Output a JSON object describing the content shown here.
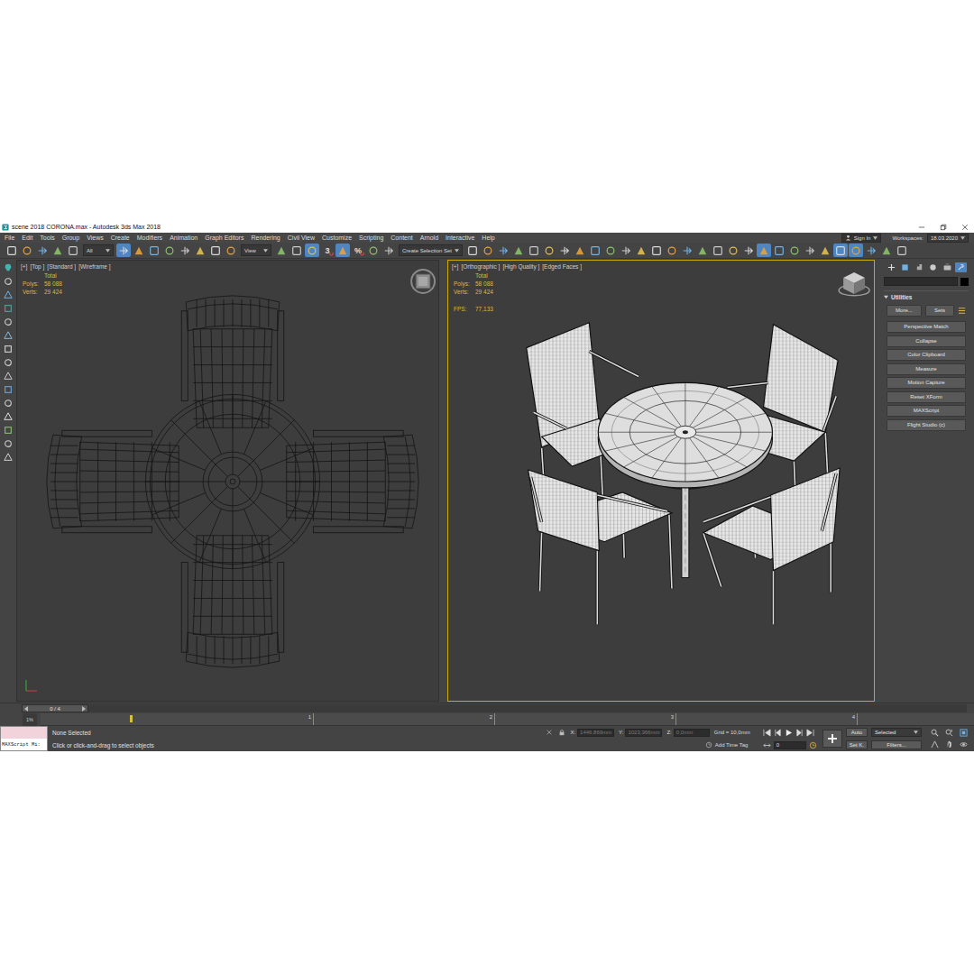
{
  "window": {
    "title": "scene 2018 CORONA.max - Autodesk 3ds Max 2018"
  },
  "menu": [
    "File",
    "Edit",
    "Tools",
    "Group",
    "Views",
    "Create",
    "Modifiers",
    "Animation",
    "Graph Editors",
    "Rendering",
    "Civil View",
    "Customize",
    "Scripting",
    "Content",
    "Arnold",
    "Interactive",
    "Help"
  ],
  "account": {
    "label": "Sign In"
  },
  "workspaces": {
    "label": "Workspaces:",
    "value": "18.03.2020"
  },
  "toolbar": [
    {
      "kind": "icon",
      "active": false
    },
    {
      "kind": "icon",
      "active": false
    },
    {
      "kind": "icon",
      "active": false
    },
    {
      "kind": "icon",
      "active": false
    },
    {
      "kind": "icon",
      "active": false
    },
    {
      "kind": "dropdown",
      "label": "All"
    },
    {
      "kind": "icon",
      "active": true
    },
    {
      "kind": "icon",
      "active": false
    },
    {
      "kind": "icon",
      "active": false
    },
    {
      "kind": "icon",
      "active": false
    },
    {
      "kind": "icon",
      "active": false
    },
    {
      "kind": "icon",
      "active": false
    },
    {
      "kind": "icon",
      "active": false
    },
    {
      "kind": "icon",
      "active": false
    },
    {
      "kind": "dropdown",
      "label": "View"
    },
    {
      "kind": "icon",
      "active": false
    },
    {
      "kind": "icon",
      "active": false
    },
    {
      "kind": "icon",
      "active": true
    },
    {
      "kind": "glyph",
      "label": "3",
      "active": false
    },
    {
      "kind": "icon",
      "active": true
    },
    {
      "kind": "glyph",
      "label": "%",
      "active": false
    },
    {
      "kind": "icon",
      "active": false
    },
    {
      "kind": "icon",
      "active": false
    },
    {
      "kind": "dropdown",
      "label": "Create Selection Set"
    },
    {
      "kind": "icon",
      "active": false
    },
    {
      "kind": "icon",
      "active": false
    },
    {
      "kind": "icon",
      "active": false
    },
    {
      "kind": "icon",
      "active": false
    },
    {
      "kind": "icon",
      "active": false
    },
    {
      "kind": "icon",
      "active": false
    },
    {
      "kind": "icon",
      "active": false
    },
    {
      "kind": "icon",
      "active": false
    },
    {
      "kind": "icon",
      "active": false
    },
    {
      "kind": "icon",
      "active": false
    },
    {
      "kind": "icon",
      "active": false
    },
    {
      "kind": "icon",
      "active": false
    },
    {
      "kind": "icon",
      "active": false
    },
    {
      "kind": "icon",
      "active": false
    },
    {
      "kind": "icon",
      "active": false
    },
    {
      "kind": "icon",
      "active": false
    },
    {
      "kind": "icon",
      "active": false
    },
    {
      "kind": "icon",
      "active": false
    },
    {
      "kind": "icon",
      "active": false
    },
    {
      "kind": "icon",
      "active": true
    },
    {
      "kind": "icon",
      "active": false
    },
    {
      "kind": "icon",
      "active": false
    },
    {
      "kind": "icon",
      "active": false
    },
    {
      "kind": "icon",
      "active": false
    },
    {
      "kind": "icon",
      "active": true
    },
    {
      "kind": "icon",
      "active": true
    },
    {
      "kind": "icon",
      "active": false
    },
    {
      "kind": "icon",
      "active": false
    },
    {
      "kind": "icon",
      "active": false
    }
  ],
  "viewports": [
    {
      "kind": "top",
      "active": false,
      "labels": [
        "[+]",
        "[Top ]",
        "[Standard ]",
        "[Wireframe ]"
      ],
      "stats": {
        "title": "Total",
        "rows": [
          {
            "label": "Polys:",
            "value": "58 088"
          },
          {
            "label": "Verts:",
            "value": "29 424"
          }
        ]
      }
    },
    {
      "kind": "orthographic",
      "active": true,
      "labels": [
        "[+]",
        "[Orthographic ]",
        "[High Quality ]",
        "[Edged Faces ]"
      ],
      "stats": {
        "title": "Total",
        "rows": [
          {
            "label": "Polys:",
            "value": "58 088"
          },
          {
            "label": "Verts:",
            "value": "29 424"
          }
        ]
      },
      "fps": {
        "label": "FPS:",
        "value": "77,133"
      }
    }
  ],
  "command_panel": {
    "tabs": [
      {
        "selected": false
      },
      {
        "selected": false
      },
      {
        "selected": false
      },
      {
        "selected": false
      },
      {
        "selected": false
      },
      {
        "selected": true
      }
    ],
    "rollout": "Utilities",
    "actions": [
      "More...",
      "Sets"
    ],
    "utilities": [
      "Perspective Match",
      "Collapse",
      "Color Clipboard",
      "Measure",
      "Motion Capture",
      "Reset XForm",
      "MAXScript",
      "Flight Studio (c)"
    ]
  },
  "time_slider": {
    "label": "0 / 4",
    "level": 0
  },
  "track_bar": {
    "zoom": "1%",
    "ticks": [
      "1",
      "2",
      "3",
      "4"
    ]
  },
  "status": {
    "listener": "MAXScript Mi:",
    "selection": "None Selected",
    "prompt": "Click or click-and-drag to select objects",
    "coords": [
      {
        "axis": "X:",
        "value": "1446,869mm",
        "disabled": true
      },
      {
        "axis": "Y:",
        "value": "1023,366mm",
        "disabled": true
      },
      {
        "axis": "Z:",
        "value": "0,0mm",
        "disabled": true
      }
    ],
    "grid": "Grid = 10,0mm",
    "time_tag": "Add Time Tag",
    "auto_key": {
      "label": "Auto",
      "on": false
    },
    "key_mode": "Selected",
    "set_key": "Set K.",
    "filters": "Filters...",
    "frame": "0"
  }
}
